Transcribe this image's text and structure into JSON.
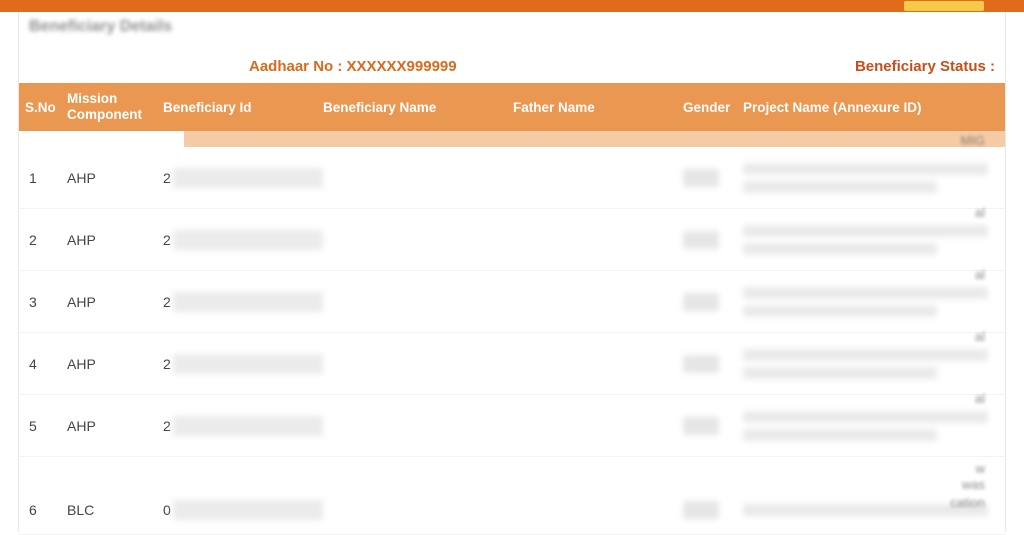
{
  "page_title": "Beneficiary Details",
  "aadhaar_label": "Aadhaar No :",
  "aadhaar_value": "XXXXXX999999",
  "status_label": "Beneficiary Status :",
  "headers": {
    "sno": "S.No",
    "mission": "Mission Component",
    "benid": "Beneficiary Id",
    "benname": "Beneficiary Name",
    "father": "Father Name",
    "gender": "Gender",
    "project": "Project Name (Annexure ID)"
  },
  "rows": [
    {
      "sno": "1",
      "mission": "AHP",
      "benid_prefix": "2",
      "edge": "MIG"
    },
    {
      "sno": "2",
      "mission": "AHP",
      "benid_prefix": "2",
      "edge": "al"
    },
    {
      "sno": "3",
      "mission": "AHP",
      "benid_prefix": "2",
      "edge": "al"
    },
    {
      "sno": "4",
      "mission": "AHP",
      "benid_prefix": "2",
      "edge": "al"
    },
    {
      "sno": "5",
      "mission": "AHP",
      "benid_prefix": "2",
      "edge": "al"
    },
    {
      "sno": "6",
      "mission": "BLC",
      "benid_prefix": "0",
      "edge": "cation"
    }
  ],
  "extra_edges": [
    "w",
    "was"
  ]
}
